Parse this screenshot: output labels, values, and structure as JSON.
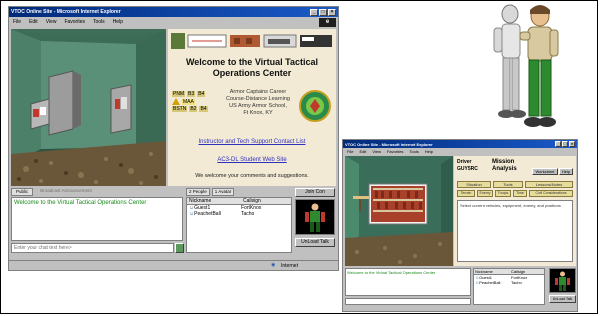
{
  "main_window": {
    "title": "VTOC Online Site - Microsoft Internet Explorer",
    "menu": [
      "File",
      "Edit",
      "View",
      "Favorites",
      "Tools",
      "Help"
    ],
    "welcome": "Welcome to the Virtual Tactical Operations Center",
    "school_lines": [
      "Armor Captains Career",
      "Course-Distance Learning",
      "US Army Armor School,",
      "Ft Knox, KY"
    ],
    "codes": [
      "PNM",
      "B3",
      "B4",
      "MAA",
      "BSTN",
      "B2",
      "B4"
    ],
    "link_support": "Instructor and Tech Support Contact List",
    "link_web": "AC3-DL Student Web Site",
    "welcome_note": "We welcome your comments and suggestions.",
    "chat_tabs": [
      "Public",
      "Broadcast Announcement"
    ],
    "chat_message": "Welcome to the Virtual Tactical Operations Center",
    "chat_placeholder": "Enter your chat text here>",
    "people_tabs": [
      "2 People",
      "1 Avatar"
    ],
    "join_button": "Join Con",
    "col_nickname": "Nickname",
    "col_callsign": "Callsign",
    "people": [
      {
        "nick": "Guest1",
        "call": "FortKnox"
      },
      {
        "nick": "PeachetBall",
        "call": "Tacho"
      }
    ],
    "unload_label": "UnLoad Talk",
    "status_text": "Internet"
  },
  "second_window": {
    "title": "VTOC Online Site - Microsoft Internet Explorer",
    "menu": [
      "File",
      "Edit",
      "View",
      "Favorites",
      "Tools",
      "Help"
    ],
    "driver_label": "Driver",
    "driver_name": "GUY5RC",
    "mission_title": "Mission Analysis",
    "top_buttons": [
      "Worksheet",
      "Help"
    ],
    "row1_buttons": [
      "Situation",
      "Tools",
      "Lessons/Notes"
    ],
    "row2_buttons": [
      "Terrain",
      "Enemy",
      "Troops",
      "Time",
      "Civil Considerations"
    ],
    "instructions": "Select current vehicles, equipment, enemy, and positions",
    "chat_message": "Welcome to the Virtual Tactical Operations Center",
    "col_nickname": "Nickname",
    "col_callsign": "Callsign",
    "people": [
      {
        "nick": "Guest1",
        "call": "FortKnox"
      },
      {
        "nick": "PeachetBall",
        "call": "Tacho"
      }
    ],
    "unload_label": "UnLoad Talk"
  }
}
